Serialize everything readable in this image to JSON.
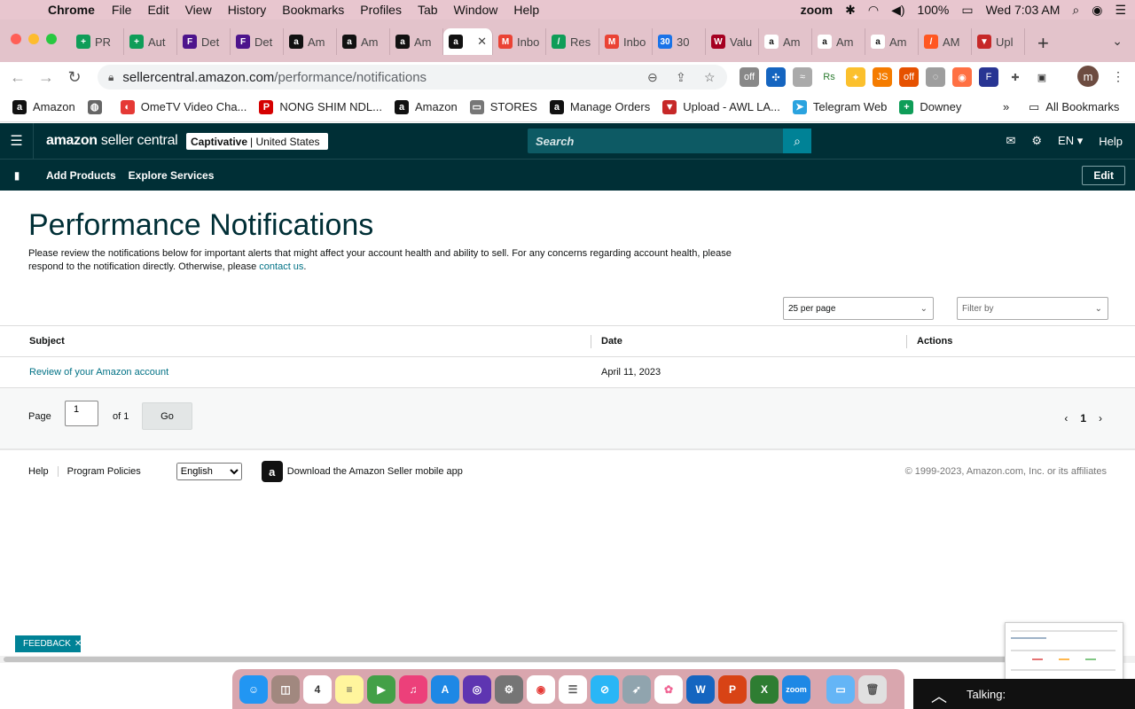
{
  "menubar": {
    "app": "Chrome",
    "items": [
      "File",
      "Edit",
      "View",
      "History",
      "Bookmarks",
      "Profiles",
      "Tab",
      "Window",
      "Help"
    ],
    "zoom": "zoom",
    "battery": "100%",
    "clock": "Wed 7:03 AM"
  },
  "tabs": [
    {
      "label": "PR",
      "color": "#0f9d58",
      "glyph": "+"
    },
    {
      "label": "Aut",
      "color": "#0f9d58",
      "glyph": "+"
    },
    {
      "label": "Det",
      "color": "#4d148c",
      "glyph": "F"
    },
    {
      "label": "Det",
      "color": "#4d148c",
      "glyph": "F"
    },
    {
      "label": "Am",
      "color": "#111",
      "glyph": "a"
    },
    {
      "label": "Am",
      "color": "#111",
      "glyph": "a"
    },
    {
      "label": "Am",
      "color": "#111",
      "glyph": "a"
    },
    {
      "label": "",
      "color": "#111",
      "glyph": "a",
      "active": true
    },
    {
      "label": "Inbo",
      "color": "#ea4335",
      "glyph": "M"
    },
    {
      "label": "Res",
      "color": "#0f9d58",
      "glyph": "/"
    },
    {
      "label": "Inbo",
      "color": "#ea4335",
      "glyph": "M"
    },
    {
      "label": "30",
      "color": "#1a73e8",
      "glyph": "30"
    },
    {
      "label": "Valu",
      "color": "#a50021",
      "glyph": "W"
    },
    {
      "label": "Am",
      "color": "#fff",
      "glyph": "a"
    },
    {
      "label": "Am",
      "color": "#fff",
      "glyph": "a"
    },
    {
      "label": "Am",
      "color": "#fff",
      "glyph": "a"
    },
    {
      "label": "AM",
      "color": "#ff5722",
      "glyph": "/"
    },
    {
      "label": "Upl",
      "color": "#c62828",
      "glyph": "▼"
    }
  ],
  "url": {
    "host": "sellercentral.amazon.com",
    "path": "/performance/notifications"
  },
  "bookmarks": [
    {
      "label": "Amazon",
      "color": "#111",
      "glyph": "a"
    },
    {
      "label": "",
      "color": "#666",
      "glyph": "◍"
    },
    {
      "label": "OmeTV Video Cha...",
      "color": "#e53935",
      "glyph": "◐"
    },
    {
      "label": "NONG SHIM NDL...",
      "color": "#d50000",
      "glyph": "P"
    },
    {
      "label": "Amazon",
      "color": "#111",
      "glyph": "a"
    },
    {
      "label": "STORES",
      "color": "#777",
      "glyph": "▭"
    },
    {
      "label": "Manage Orders",
      "color": "#111",
      "glyph": "a"
    },
    {
      "label": "Upload - AWL LA...",
      "color": "#c62828",
      "glyph": "▼"
    },
    {
      "label": "Telegram Web",
      "color": "#2aa3df",
      "glyph": "➤"
    },
    {
      "label": "Downey",
      "color": "#0f9d58",
      "glyph": "+"
    }
  ],
  "bookmarks_more": "»",
  "all_bookmarks": "All Bookmarks",
  "header": {
    "logo_a": "amazon",
    "logo_b": " seller central",
    "store_name": "Captivative",
    "store_region": "| United States",
    "search_placeholder": "Search",
    "lang": "EN",
    "help": "Help"
  },
  "subnav": {
    "add": "Add Products",
    "explore": "Explore Services",
    "edit": "Edit"
  },
  "page": {
    "title": "Performance Notifications",
    "intro": "Please review the notifications below for important alerts that might affect your account health and ability to sell. For any concerns regarding account health, please respond to the notification directly. Otherwise, please ",
    "intro_link": "contact us",
    "intro_end": "."
  },
  "controls": {
    "per_page": "25 per page",
    "filter": "Filter by"
  },
  "table": {
    "headers": [
      "Subject",
      "Date",
      "Actions"
    ],
    "rows": [
      {
        "subject": "Review of your Amazon account",
        "date": "April 11, 2023",
        "actions": ""
      }
    ]
  },
  "pager": {
    "page_label": "Page",
    "page_value": "1",
    "of": "of 1",
    "go": "Go",
    "current": "1"
  },
  "footer": {
    "help": "Help",
    "policies": "Program Policies",
    "language": "English",
    "download": "Download the Amazon Seller mobile app",
    "copyright": "© 1999-2023, Amazon.com, Inc. or its affiliates"
  },
  "feedback": "FEEDBACK",
  "zoom_talking": "Talking:"
}
